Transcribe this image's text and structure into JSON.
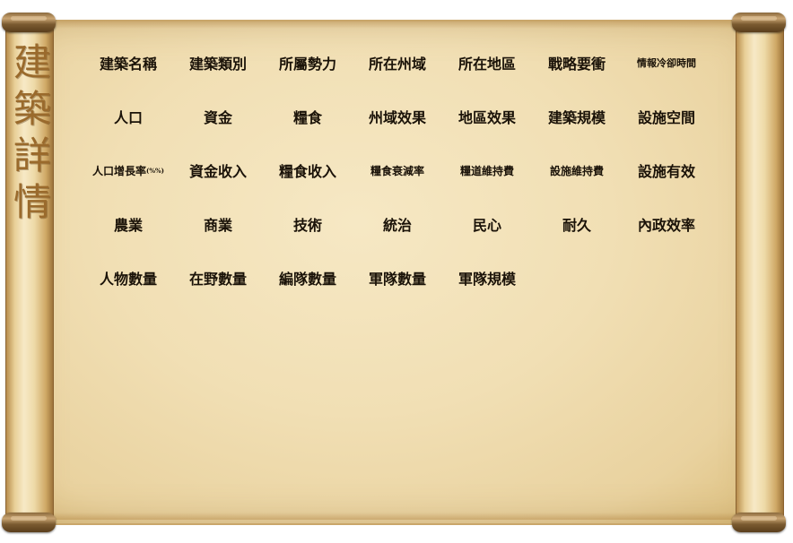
{
  "panel": {
    "title_chars": [
      "建",
      "築",
      "詳",
      "情"
    ]
  },
  "attributes": [
    "建築名稱",
    "建築類別",
    "所屬勢力",
    "所在州域",
    "所在地區",
    "戰略要衝",
    "情報冷卻時間",
    "人口",
    "資金",
    "糧食",
    "州域效果",
    "地區效果",
    "建築規模",
    "設施空間",
    "人口增長率",
    "資金收入",
    "糧食收入",
    "糧食衰減率",
    "糧道維持費",
    "設施維持費",
    "設施有效",
    "農業",
    "商業",
    "技術",
    "統治",
    "民心",
    "耐久",
    "內政效率",
    "人物數量",
    "在野數量",
    "編隊數量",
    "軍隊數量",
    "軍隊規模"
  ],
  "pop_growth_unit": "(%%)",
  "colors": {
    "title": "#9a6a2c",
    "text": "#1a1208",
    "parchment": "#f1dfb4"
  }
}
